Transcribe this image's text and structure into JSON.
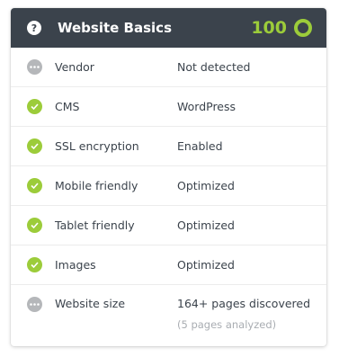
{
  "card": {
    "title": "Website Basics",
    "score": "100",
    "score_color": "#9ccc3a",
    "help_icon_glyph": "?"
  },
  "rows": [
    {
      "label": "Vendor",
      "value": "Not detected",
      "status": "neutral"
    },
    {
      "label": "CMS",
      "value": "WordPress",
      "status": "ok"
    },
    {
      "label": "SSL encryption",
      "value": "Enabled",
      "status": "ok"
    },
    {
      "label": "Mobile friendly",
      "value": "Optimized",
      "status": "ok"
    },
    {
      "label": "Tablet friendly",
      "value": "Optimized",
      "status": "ok"
    },
    {
      "label": "Images",
      "value": "Optimized",
      "status": "ok"
    },
    {
      "label": "Website size",
      "value": "164+ pages discovered",
      "subvalue": "(5 pages analyzed)",
      "status": "neutral"
    }
  ],
  "icons": {
    "ok": "check-circle-icon",
    "neutral": "more-dots-icon"
  }
}
